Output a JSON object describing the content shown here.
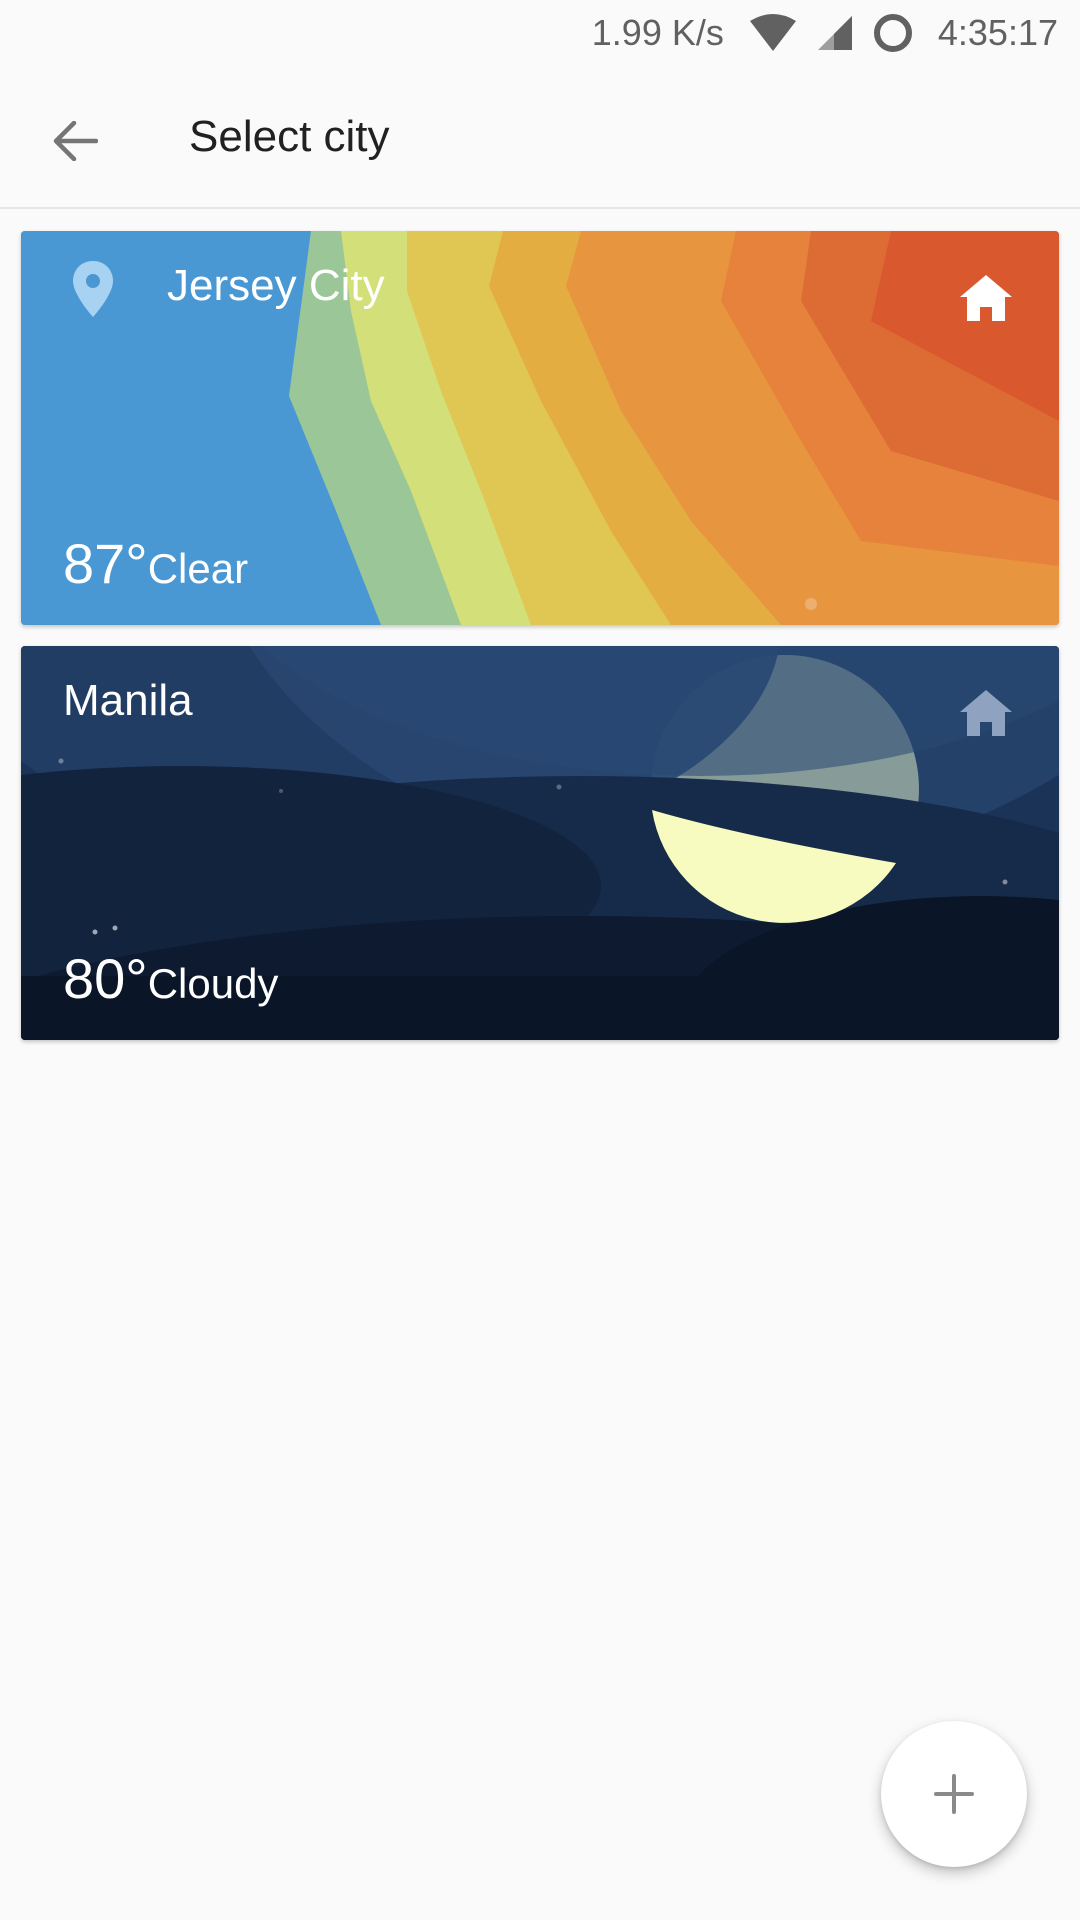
{
  "status_bar": {
    "net_speed": "1.99 K/s",
    "time": "4:35:17",
    "icons": [
      "wifi-icon",
      "cell-signal-icon",
      "loading-ring-icon"
    ]
  },
  "app_bar": {
    "back_icon": "arrow-back-icon",
    "title": "Select city"
  },
  "cities": [
    {
      "name": "Jersey City",
      "temperature": "87°",
      "condition": "Clear",
      "location_icon": "location-pin-icon",
      "home_icon": "home-icon",
      "theme": "clear-day",
      "colors": [
        "#4a98d3",
        "#9bc698",
        "#d3df78",
        "#e0c652",
        "#e4ad42",
        "#e7953f",
        "#e7823d",
        "#dd6b34",
        "#d9582d",
        "#d1432a"
      ]
    },
    {
      "name": "Manila",
      "temperature": "80°",
      "condition": "Cloudy",
      "home_icon": "home-icon",
      "theme": "cloudy-night",
      "colors": [
        "#0a1628",
        "#12233e",
        "#1c3358",
        "#264770",
        "#f7fbbf"
      ]
    }
  ],
  "fab": {
    "icon": "plus-icon",
    "label": "+"
  }
}
